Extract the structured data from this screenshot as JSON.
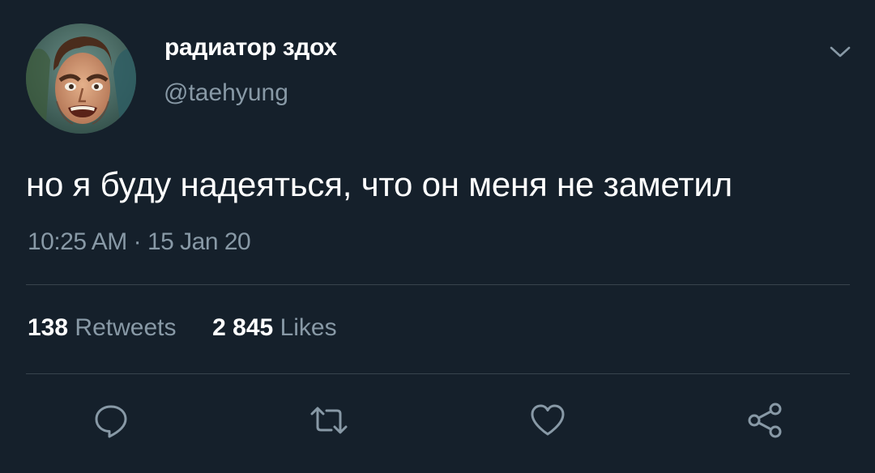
{
  "user": {
    "name": "радиатор здох",
    "handle": "@taehyung"
  },
  "tweet": {
    "text": "но я буду надеяться, что он меня не заметил",
    "time": "10:25 AM",
    "separator": "·",
    "date": "15 Jan 20"
  },
  "stats": {
    "retweets_count": "138",
    "retweets_label": "Retweets",
    "likes_count": "2 845",
    "likes_label": "Likes"
  },
  "icons": {
    "menu": "chevron-down-icon",
    "reply": "reply-icon",
    "retweet": "retweet-icon",
    "like": "heart-icon",
    "share": "share-icon"
  },
  "colors": {
    "background": "#15202b",
    "primary_text": "#ffffff",
    "secondary_text": "#8899a6",
    "divider": "#38444d"
  }
}
